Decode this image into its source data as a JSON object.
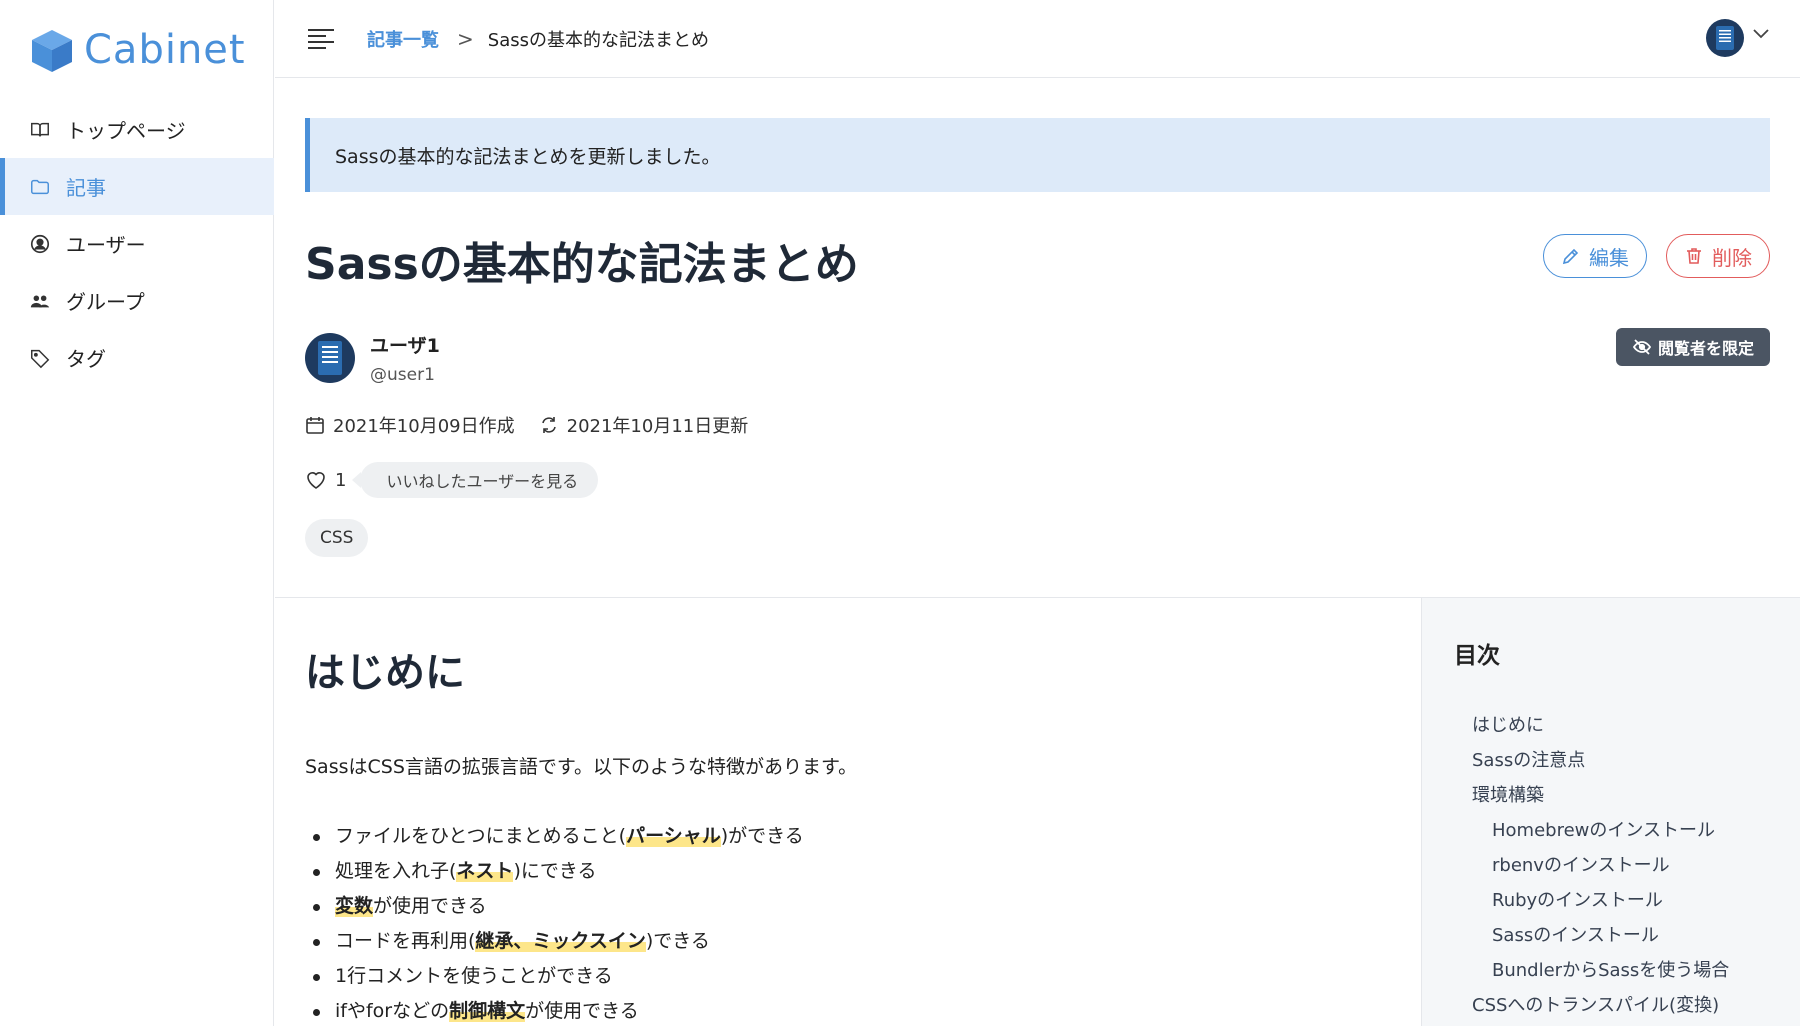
{
  "brand": {
    "name": "Cabinet",
    "accent": "#4a90d9"
  },
  "sidebar": {
    "items": [
      {
        "label": "トップページ",
        "icon": "book-icon",
        "active": false
      },
      {
        "label": "記事",
        "icon": "folder-icon",
        "active": true
      },
      {
        "label": "ユーザー",
        "icon": "user-circle-icon",
        "active": false
      },
      {
        "label": "グループ",
        "icon": "users-icon",
        "active": false
      },
      {
        "label": "タグ",
        "icon": "tag-icon",
        "active": false
      }
    ]
  },
  "header": {
    "breadcrumb_root": "記事一覧",
    "breadcrumb_separator": ">",
    "breadcrumb_current": "Sassの基本的な記法まとめ"
  },
  "flash": {
    "message": "Sassの基本的な記法まとめを更新しました。"
  },
  "article": {
    "title": "Sassの基本的な記法まとめ",
    "edit_label": "編集",
    "delete_label": "削除",
    "author_name": "ユーザ1",
    "author_handle": "@user1",
    "restricted_label": "閲覧者を限定",
    "created": "2021年10月09日作成",
    "updated": "2021年10月11日更新",
    "like_count": "1",
    "like_users_label": "いいねしたユーザーを見る",
    "tags": [
      "CSS"
    ]
  },
  "content": {
    "heading": "はじめに",
    "intro": "SassはCSS言語の拡張言語です。以下のような特徴があります。",
    "features": [
      {
        "before": "ファイルをひとつにまとめること(",
        "highlight": "パーシャル",
        "after": ")ができる"
      },
      {
        "before": "処理を入れ子(",
        "highlight": "ネスト",
        "after": ")にできる"
      },
      {
        "before": "",
        "highlight": "変数",
        "after": "が使用できる"
      },
      {
        "before": "コードを再利用(",
        "highlight": "継承、ミックスイン",
        "after": ")できる"
      },
      {
        "before": "1行コメントを使うことができる",
        "highlight": "",
        "after": ""
      },
      {
        "before": "ifやforなどの",
        "highlight": "制御構文",
        "after": "が使用できる"
      }
    ]
  },
  "toc": {
    "title": "目次",
    "items": [
      {
        "label": "はじめに",
        "level": 1
      },
      {
        "label": "Sassの注意点",
        "level": 1
      },
      {
        "label": "環境構築",
        "level": 1
      },
      {
        "label": "Homebrewのインストール",
        "level": 2
      },
      {
        "label": "rbenvのインストール",
        "level": 2
      },
      {
        "label": "Rubyのインストール",
        "level": 2
      },
      {
        "label": "Sassのインストール",
        "level": 2
      },
      {
        "label": "BundlerからSassを使う場合",
        "level": 2
      },
      {
        "label": "CSSへのトランスパイル(変換)",
        "level": 1
      }
    ]
  }
}
